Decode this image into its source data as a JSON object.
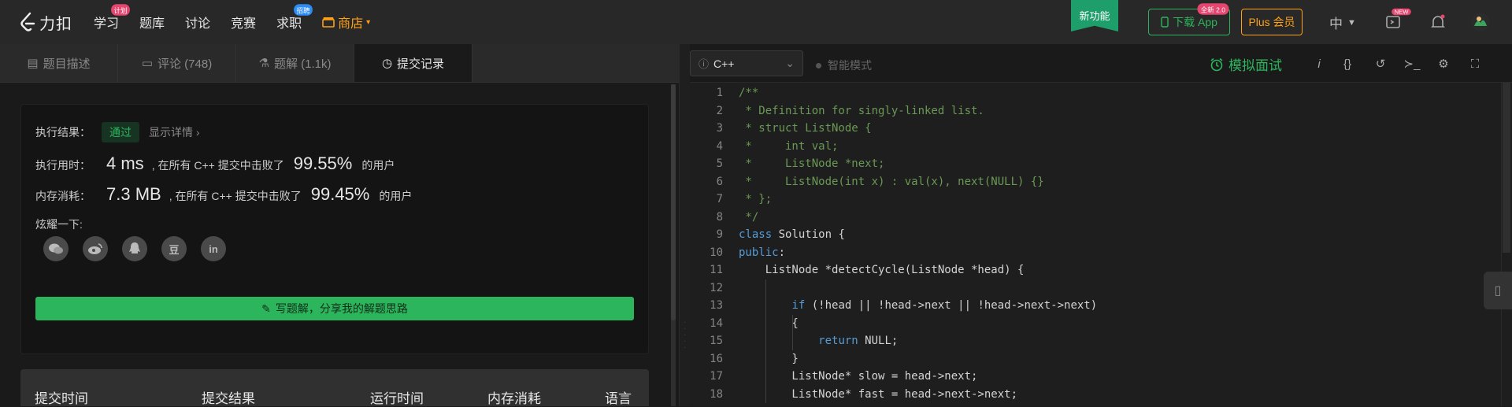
{
  "topnav": {
    "logo_text": "力扣",
    "items": [
      {
        "label": "学习",
        "badge": "计划",
        "badge_color": "#e5456f"
      },
      {
        "label": "题库"
      },
      {
        "label": "讨论"
      },
      {
        "label": "竞赛"
      },
      {
        "label": "求职",
        "badge": "招聘",
        "badge_color": "#2c8bf5"
      }
    ],
    "shop_label": "商店",
    "new_feature": "新功能",
    "download_label": "下载 App",
    "download_badge": "全新 2.0",
    "plus_label": "Plus 会员",
    "lang": "中",
    "icon_badge_new": "NEW"
  },
  "tabs": [
    {
      "label": "题目描述",
      "icon": "doc-icon"
    },
    {
      "label": "评论 (748)",
      "icon": "comment-icon"
    },
    {
      "label": "题解 (1.1k)",
      "icon": "flask-icon"
    },
    {
      "label": "提交记录",
      "icon": "clock-icon",
      "active": true
    }
  ],
  "result": {
    "exec_label": "执行结果：",
    "status": "通过",
    "details_link": "显示详情 ›",
    "time_label": "执行用时：",
    "time_value": "4 ms",
    "time_mid": ", 在所有 C++ 提交中击败了",
    "time_pct": "99.55%",
    "time_tail": "的用户",
    "mem_label": "内存消耗：",
    "mem_value": "7.3 MB",
    "mem_mid": ", 在所有 C++ 提交中击败了",
    "mem_pct": "99.45%",
    "mem_tail": "的用户",
    "share_label": "炫耀一下:",
    "share_icons": [
      "wechat-icon",
      "weibo-icon",
      "qq-icon",
      "douban-icon",
      "linkedin-icon"
    ],
    "share_glyphs": [
      "",
      "",
      "",
      "豆",
      "in"
    ],
    "write_solution": "写题解，分享我的解题思路"
  },
  "table": {
    "headers": [
      "提交时间",
      "提交结果",
      "运行时间",
      "内存消耗",
      "语言"
    ]
  },
  "editor": {
    "language": "C++",
    "smart_mode": "智能模式",
    "mock_interview": "模拟面试",
    "toolbar_icons": [
      "info-icon",
      "braces-icon",
      "reset-icon",
      "terminal-icon",
      "settings-icon",
      "fullscreen-icon"
    ],
    "toolbar_glyphs": [
      "i",
      "{}",
      "↺",
      "≻_",
      "⚙",
      "⛶"
    ]
  },
  "code": [
    {
      "n": "1",
      "t": [
        [
          "c",
          "/**"
        ]
      ]
    },
    {
      "n": "2",
      "t": [
        [
          "c",
          " * Definition for singly-linked list."
        ]
      ]
    },
    {
      "n": "3",
      "t": [
        [
          "c",
          " * struct ListNode {"
        ]
      ]
    },
    {
      "n": "4",
      "t": [
        [
          "c",
          " *     int val;"
        ]
      ]
    },
    {
      "n": "5",
      "t": [
        [
          "c",
          " *     ListNode *next;"
        ]
      ]
    },
    {
      "n": "6",
      "t": [
        [
          "c",
          " *     ListNode(int x) : val(x), next(NULL) {}"
        ]
      ]
    },
    {
      "n": "7",
      "t": [
        [
          "c",
          " * };"
        ]
      ]
    },
    {
      "n": "8",
      "t": [
        [
          "c",
          " */"
        ]
      ]
    },
    {
      "n": "9",
      "t": [
        [
          "k",
          "class"
        ],
        [
          "p",
          " Solution {"
        ]
      ]
    },
    {
      "n": "10",
      "t": [
        [
          "k",
          "public"
        ],
        [
          "p",
          ":"
        ]
      ]
    },
    {
      "n": "11",
      "t": [
        [
          "p",
          "    ListNode *detectCycle(ListNode *head) {"
        ]
      ]
    },
    {
      "n": "12",
      "t": [
        [
          "p",
          ""
        ]
      ]
    },
    {
      "n": "13",
      "t": [
        [
          "p",
          "        "
        ],
        [
          "k",
          "if"
        ],
        [
          "p",
          " (!head || !head->next || !head->next->next)"
        ]
      ]
    },
    {
      "n": "14",
      "t": [
        [
          "p",
          "        {"
        ]
      ]
    },
    {
      "n": "15",
      "t": [
        [
          "p",
          "            "
        ],
        [
          "k",
          "return"
        ],
        [
          "p",
          " NULL;"
        ]
      ]
    },
    {
      "n": "16",
      "t": [
        [
          "p",
          "        }"
        ]
      ]
    },
    {
      "n": "17",
      "t": [
        [
          "p",
          "        ListNode* slow = head->next;"
        ]
      ]
    },
    {
      "n": "18",
      "t": [
        [
          "p",
          "        ListNode* fast = head->next->next;"
        ]
      ]
    }
  ]
}
